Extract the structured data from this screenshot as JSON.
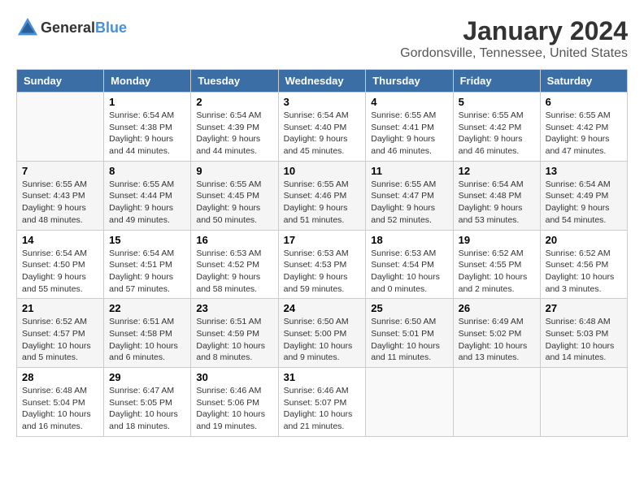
{
  "logo": {
    "text_general": "General",
    "text_blue": "Blue"
  },
  "title": {
    "month": "January 2024",
    "location": "Gordonsville, Tennessee, United States"
  },
  "headers": [
    "Sunday",
    "Monday",
    "Tuesday",
    "Wednesday",
    "Thursday",
    "Friday",
    "Saturday"
  ],
  "weeks": [
    [
      {
        "day": "",
        "sunrise": "",
        "sunset": "",
        "daylight": ""
      },
      {
        "day": "1",
        "sunrise": "Sunrise: 6:54 AM",
        "sunset": "Sunset: 4:38 PM",
        "daylight": "Daylight: 9 hours and 44 minutes."
      },
      {
        "day": "2",
        "sunrise": "Sunrise: 6:54 AM",
        "sunset": "Sunset: 4:39 PM",
        "daylight": "Daylight: 9 hours and 44 minutes."
      },
      {
        "day": "3",
        "sunrise": "Sunrise: 6:54 AM",
        "sunset": "Sunset: 4:40 PM",
        "daylight": "Daylight: 9 hours and 45 minutes."
      },
      {
        "day": "4",
        "sunrise": "Sunrise: 6:55 AM",
        "sunset": "Sunset: 4:41 PM",
        "daylight": "Daylight: 9 hours and 46 minutes."
      },
      {
        "day": "5",
        "sunrise": "Sunrise: 6:55 AM",
        "sunset": "Sunset: 4:42 PM",
        "daylight": "Daylight: 9 hours and 46 minutes."
      },
      {
        "day": "6",
        "sunrise": "Sunrise: 6:55 AM",
        "sunset": "Sunset: 4:42 PM",
        "daylight": "Daylight: 9 hours and 47 minutes."
      }
    ],
    [
      {
        "day": "7",
        "sunrise": "Sunrise: 6:55 AM",
        "sunset": "Sunset: 4:43 PM",
        "daylight": "Daylight: 9 hours and 48 minutes."
      },
      {
        "day": "8",
        "sunrise": "Sunrise: 6:55 AM",
        "sunset": "Sunset: 4:44 PM",
        "daylight": "Daylight: 9 hours and 49 minutes."
      },
      {
        "day": "9",
        "sunrise": "Sunrise: 6:55 AM",
        "sunset": "Sunset: 4:45 PM",
        "daylight": "Daylight: 9 hours and 50 minutes."
      },
      {
        "day": "10",
        "sunrise": "Sunrise: 6:55 AM",
        "sunset": "Sunset: 4:46 PM",
        "daylight": "Daylight: 9 hours and 51 minutes."
      },
      {
        "day": "11",
        "sunrise": "Sunrise: 6:55 AM",
        "sunset": "Sunset: 4:47 PM",
        "daylight": "Daylight: 9 hours and 52 minutes."
      },
      {
        "day": "12",
        "sunrise": "Sunrise: 6:54 AM",
        "sunset": "Sunset: 4:48 PM",
        "daylight": "Daylight: 9 hours and 53 minutes."
      },
      {
        "day": "13",
        "sunrise": "Sunrise: 6:54 AM",
        "sunset": "Sunset: 4:49 PM",
        "daylight": "Daylight: 9 hours and 54 minutes."
      }
    ],
    [
      {
        "day": "14",
        "sunrise": "Sunrise: 6:54 AM",
        "sunset": "Sunset: 4:50 PM",
        "daylight": "Daylight: 9 hours and 55 minutes."
      },
      {
        "day": "15",
        "sunrise": "Sunrise: 6:54 AM",
        "sunset": "Sunset: 4:51 PM",
        "daylight": "Daylight: 9 hours and 57 minutes."
      },
      {
        "day": "16",
        "sunrise": "Sunrise: 6:53 AM",
        "sunset": "Sunset: 4:52 PM",
        "daylight": "Daylight: 9 hours and 58 minutes."
      },
      {
        "day": "17",
        "sunrise": "Sunrise: 6:53 AM",
        "sunset": "Sunset: 4:53 PM",
        "daylight": "Daylight: 9 hours and 59 minutes."
      },
      {
        "day": "18",
        "sunrise": "Sunrise: 6:53 AM",
        "sunset": "Sunset: 4:54 PM",
        "daylight": "Daylight: 10 hours and 0 minutes."
      },
      {
        "day": "19",
        "sunrise": "Sunrise: 6:52 AM",
        "sunset": "Sunset: 4:55 PM",
        "daylight": "Daylight: 10 hours and 2 minutes."
      },
      {
        "day": "20",
        "sunrise": "Sunrise: 6:52 AM",
        "sunset": "Sunset: 4:56 PM",
        "daylight": "Daylight: 10 hours and 3 minutes."
      }
    ],
    [
      {
        "day": "21",
        "sunrise": "Sunrise: 6:52 AM",
        "sunset": "Sunset: 4:57 PM",
        "daylight": "Daylight: 10 hours and 5 minutes."
      },
      {
        "day": "22",
        "sunrise": "Sunrise: 6:51 AM",
        "sunset": "Sunset: 4:58 PM",
        "daylight": "Daylight: 10 hours and 6 minutes."
      },
      {
        "day": "23",
        "sunrise": "Sunrise: 6:51 AM",
        "sunset": "Sunset: 4:59 PM",
        "daylight": "Daylight: 10 hours and 8 minutes."
      },
      {
        "day": "24",
        "sunrise": "Sunrise: 6:50 AM",
        "sunset": "Sunset: 5:00 PM",
        "daylight": "Daylight: 10 hours and 9 minutes."
      },
      {
        "day": "25",
        "sunrise": "Sunrise: 6:50 AM",
        "sunset": "Sunset: 5:01 PM",
        "daylight": "Daylight: 10 hours and 11 minutes."
      },
      {
        "day": "26",
        "sunrise": "Sunrise: 6:49 AM",
        "sunset": "Sunset: 5:02 PM",
        "daylight": "Daylight: 10 hours and 13 minutes."
      },
      {
        "day": "27",
        "sunrise": "Sunrise: 6:48 AM",
        "sunset": "Sunset: 5:03 PM",
        "daylight": "Daylight: 10 hours and 14 minutes."
      }
    ],
    [
      {
        "day": "28",
        "sunrise": "Sunrise: 6:48 AM",
        "sunset": "Sunset: 5:04 PM",
        "daylight": "Daylight: 10 hours and 16 minutes."
      },
      {
        "day": "29",
        "sunrise": "Sunrise: 6:47 AM",
        "sunset": "Sunset: 5:05 PM",
        "daylight": "Daylight: 10 hours and 18 minutes."
      },
      {
        "day": "30",
        "sunrise": "Sunrise: 6:46 AM",
        "sunset": "Sunset: 5:06 PM",
        "daylight": "Daylight: 10 hours and 19 minutes."
      },
      {
        "day": "31",
        "sunrise": "Sunrise: 6:46 AM",
        "sunset": "Sunset: 5:07 PM",
        "daylight": "Daylight: 10 hours and 21 minutes."
      },
      {
        "day": "",
        "sunrise": "",
        "sunset": "",
        "daylight": ""
      },
      {
        "day": "",
        "sunrise": "",
        "sunset": "",
        "daylight": ""
      },
      {
        "day": "",
        "sunrise": "",
        "sunset": "",
        "daylight": ""
      }
    ]
  ]
}
